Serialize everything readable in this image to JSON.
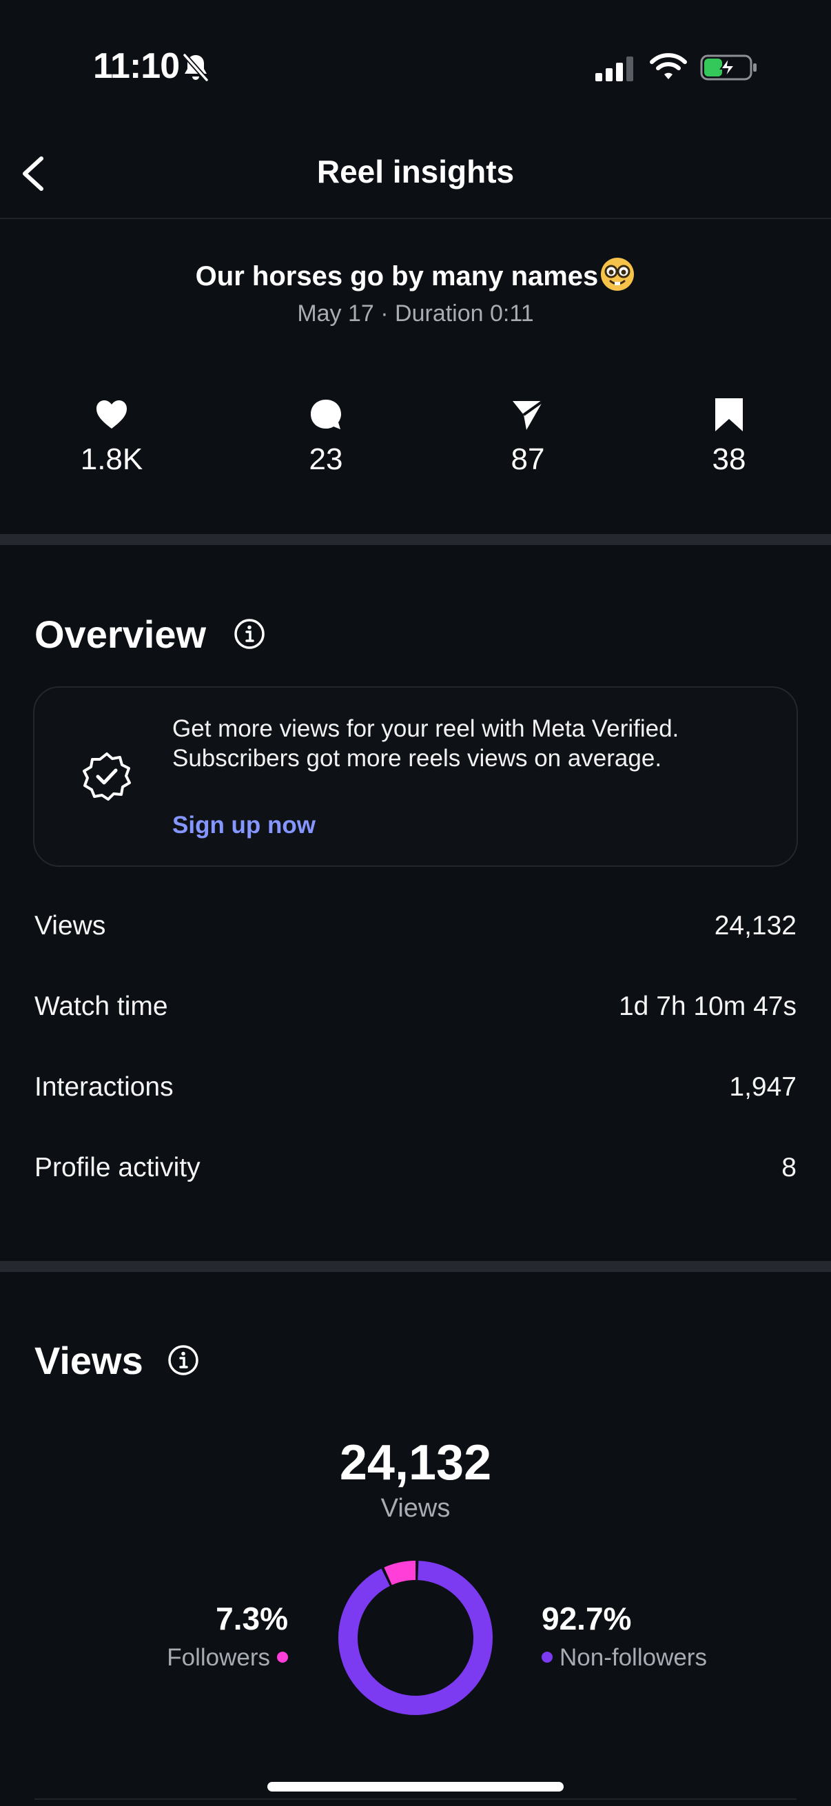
{
  "status_bar": {
    "time": "11:10",
    "icons": [
      "bell-slash-icon",
      "cellular-signal-icon",
      "wifi-icon",
      "battery-charging-icon"
    ]
  },
  "nav": {
    "title": "Reel insights",
    "back_icon": "chevron-left-icon"
  },
  "reel": {
    "title": "Our horses go by many names",
    "title_emoji": "nerd-face-emoji",
    "meta": "May 17 · Duration 0:11"
  },
  "stats": [
    {
      "icon": "heart-icon",
      "value": "1.8K"
    },
    {
      "icon": "comment-icon",
      "value": "23"
    },
    {
      "icon": "share-icon",
      "value": "87"
    },
    {
      "icon": "bookmark-icon",
      "value": "38"
    }
  ],
  "overview": {
    "title": "Overview",
    "promo": {
      "text": "Get more views for your reel with Meta Verified. Subscribers got more reels views on average.",
      "link": "Sign up now",
      "icon": "verified-badge-icon"
    },
    "metrics": [
      {
        "label": "Views",
        "value": "24,132"
      },
      {
        "label": "Watch time",
        "value": "1d 7h 10m 47s"
      },
      {
        "label": "Interactions",
        "value": "1,947"
      },
      {
        "label": "Profile activity",
        "value": "8"
      }
    ]
  },
  "views_section": {
    "title": "Views",
    "total": "24,132",
    "caption": "Views"
  },
  "chart_data": {
    "type": "pie",
    "categories": [
      "Followers",
      "Non-followers"
    ],
    "values": [
      7.3,
      92.7
    ],
    "value_labels": [
      "7.3%",
      "92.7%"
    ],
    "colors": [
      "#ff3fd8",
      "#7c3bf0"
    ],
    "title": "",
    "xlabel": "",
    "ylabel": ""
  },
  "colors": {
    "background": "#0c0f14",
    "link": "#8696ff",
    "followers": "#ff3fd8",
    "non_followers": "#7c3bf0"
  }
}
